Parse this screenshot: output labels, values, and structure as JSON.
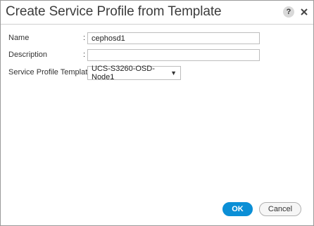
{
  "dialog": {
    "title": "Create Service Profile from Template",
    "help_glyph": "?",
    "close_glyph": "✕",
    "help_icon": "help-icon",
    "close_icon": "close-icon"
  },
  "form": {
    "name": {
      "label": "Name",
      "colon": ":",
      "value": "cephosd1"
    },
    "description": {
      "label": "Description",
      "colon": ":",
      "value": ""
    },
    "template": {
      "label": "Service Profile Template :",
      "selected": "UCS-S3260-OSD-Node1",
      "caret": "▼"
    }
  },
  "buttons": {
    "ok": "OK",
    "cancel": "Cancel"
  },
  "colors": {
    "primary": "#0b8fd6",
    "border": "#9a9a9a"
  }
}
